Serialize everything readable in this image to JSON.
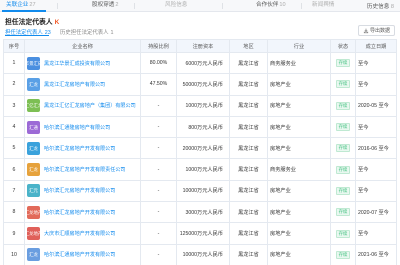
{
  "topnav": {
    "tabs": [
      {
        "label": "关联企业",
        "count": "27",
        "state": "active"
      },
      {
        "label": "股权穿透",
        "count": "2",
        "state": "normal"
      },
      {
        "label": "风险信息",
        "count": "",
        "state": "disabled"
      },
      {
        "label": "合作伙伴",
        "count": "10",
        "state": "normal"
      },
      {
        "label": "新闻舆情",
        "count": "",
        "state": "disabled"
      }
    ],
    "more_label": "历史信息",
    "more_count": "8"
  },
  "section": {
    "title": "担任法定代表人",
    "mark": "K"
  },
  "subtabs": [
    {
      "label": "担任法定代表人",
      "count": "23",
      "state": "active"
    },
    {
      "label": "历史担任法定代表人",
      "count": "1",
      "state": "inactive"
    }
  ],
  "export_label": "导出数据",
  "table": {
    "headers": [
      "序号",
      "企业名称",
      "持股比例",
      "注册资本",
      "地区",
      "行业",
      "状态",
      "成立日期"
    ],
    "rows": [
      {
        "no": "1",
        "logo": "华景汇成",
        "logo_color": "#4a8fe0",
        "name": "黑龙江华景汇成投资有限公司",
        "ratio": "80.00%",
        "capital": "6000万元人民币",
        "region": "黑龙江省",
        "industry": "商务服务业",
        "status": "存续",
        "date": "至今"
      },
      {
        "no": "2",
        "logo": "汇龙",
        "logo_color": "#5aa0e6",
        "name": "黑龙江汇龙房地产有限公司",
        "ratio": "47.50%",
        "capital": "50000万元人民币",
        "region": "黑龙江省",
        "industry": "房地产业",
        "status": "存续",
        "date": "至今"
      },
      {
        "no": "3",
        "logo": "汇亿汇龙",
        "logo_color": "#7dbf54",
        "name": "黑龙江汇亿汇龙房地产（集团）有限公司",
        "ratio": "-",
        "capital": "1000万元人民币",
        "region": "黑龙江省",
        "industry": "房地产业",
        "status": "存续",
        "date": "2020-05 至今"
      },
      {
        "no": "4",
        "logo": "汇通",
        "logo_color": "#9c6ad6",
        "name": "哈尔滨汇通隆房地产有限公司",
        "ratio": "-",
        "capital": "800万元人民币",
        "region": "黑龙江省",
        "industry": "房地产业",
        "status": "存续",
        "date": "至今"
      },
      {
        "no": "5",
        "logo": "汇龙",
        "logo_color": "#3aa2dc",
        "name": "哈尔滨汇龙房地产开发有限公司",
        "ratio": "-",
        "capital": "20000万元人民币",
        "region": "黑龙江省",
        "industry": "房地产业",
        "status": "存续",
        "date": "2016-06 至今"
      },
      {
        "no": "6",
        "logo": "汇龙",
        "logo_color": "#e6a23c",
        "name": "哈尔滨汇龙房地产开发有限责任公司",
        "ratio": "-",
        "capital": "1000万元人民币",
        "region": "黑龙江省",
        "industry": "商务服务业",
        "status": "存续",
        "date": "至今"
      },
      {
        "no": "7",
        "logo": "汇元",
        "logo_color": "#4ab3c9",
        "name": "哈尔滨汇元房地产开发有限公司",
        "ratio": "-",
        "capital": "10000万元人民币",
        "region": "黑龙江省",
        "industry": "房地产业",
        "status": "存续",
        "date": "至今"
      },
      {
        "no": "8",
        "logo": "汇龙地产",
        "logo_color": "#e26a5a",
        "name": "哈尔滨汇龙房地产开发有限公司",
        "ratio": "-",
        "capital": "3000万元人民币",
        "region": "黑龙江省",
        "industry": "房地产业",
        "status": "存续",
        "date": "2020-07 至今"
      },
      {
        "no": "9",
        "logo": "汇龙地产",
        "logo_color": "#e0605a",
        "name": "大庆市汇顺房地产开发有限公司",
        "ratio": "-",
        "capital": "125000万元人民币",
        "region": "黑龙江省",
        "industry": "房地产业",
        "status": "存续",
        "date": "至今"
      },
      {
        "no": "10",
        "logo": "汇龙",
        "logo_color": "#6a9ee0",
        "name": "哈尔滨汇通房地产开发有限公司",
        "ratio": "-",
        "capital": "10000万元人民币",
        "region": "黑龙江省",
        "industry": "房地产业",
        "status": "存续",
        "date": "2021-06 至今"
      }
    ]
  },
  "colors": {
    "accent": "#128bed",
    "status_green": "#3bbe7b",
    "mark_orange": "#f25a29"
  },
  "icons": {
    "export": "export-icon"
  }
}
